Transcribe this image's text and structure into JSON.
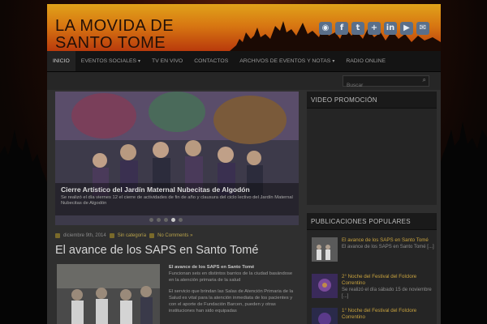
{
  "site": {
    "title_line1": "LA MOVIDA DE",
    "title_line2": "SANTO TOME"
  },
  "social": [
    {
      "icon": "rss-icon",
      "glyph": "◉"
    },
    {
      "icon": "facebook-icon",
      "glyph": "f"
    },
    {
      "icon": "twitter-icon",
      "glyph": "t"
    },
    {
      "icon": "google-plus-icon",
      "glyph": "+"
    },
    {
      "icon": "linkedin-icon",
      "glyph": "in"
    },
    {
      "icon": "youtube-icon",
      "glyph": "▶"
    },
    {
      "icon": "email-icon",
      "glyph": "✉"
    }
  ],
  "nav": {
    "items": [
      {
        "label": "INICIO"
      },
      {
        "label": "EVENTOS SOCIALES"
      },
      {
        "label": "TV EN VIVO"
      },
      {
        "label": "CONTACTOS"
      },
      {
        "label": "ARCHIVOS DE EVENTOS Y NOTAS"
      },
      {
        "label": "RADIO ONLINE"
      }
    ]
  },
  "search": {
    "placeholder": "Buscar"
  },
  "slider": {
    "title": "Cierre Artístico del Jardín Maternal Nubecitas de Algodón",
    "text": "Se realizó el día viernes 12 el cierre de actividades de fin de año y clausura del ciclo lectivo del Jardín Maternal Nubecitas de Algodón",
    "active_dot": 3
  },
  "post": {
    "date": "diciembre 9th, 2014",
    "category": "Sin categoría",
    "comments": "No Comments »",
    "title": "El avance de los SAPS en Santo Tomé",
    "body_bold": "El avance de los SAPS en Santo Tomé",
    "body_p1": "Funcionan seis en distintos barrios de la ciudad basándose en la atención primaria de la salud",
    "body_p2": "El servicio que brindan las Salas de Atención Primaria de la Salud es vital para la atención inmediata de los pacientes y con el aporte de Fundación Barcen, pueden y otras instituciones han sido equipadas"
  },
  "widgets": {
    "video": {
      "title": "VIDEO PROMOCIÓN"
    },
    "popular": {
      "title": "PUBLICACIONES POPULARES",
      "items": [
        {
          "title": "El avance de los SAPS en Santo Tomé",
          "excerpt": "El avance de los SAPS en Santo Tomé [...]"
        },
        {
          "title": "2° Noche del Festival del Folclore Correntino",
          "excerpt": "Se realizó el día sábado 15 de noviembre [...]"
        },
        {
          "title": "1° Noche del Festival del Folclore Correntino",
          "excerpt": ""
        }
      ]
    }
  },
  "colors": {
    "header_top": "#e0a21a",
    "header_bottom": "#b93a0c",
    "link": "#c9a33f",
    "nav_bg": "#141414"
  }
}
